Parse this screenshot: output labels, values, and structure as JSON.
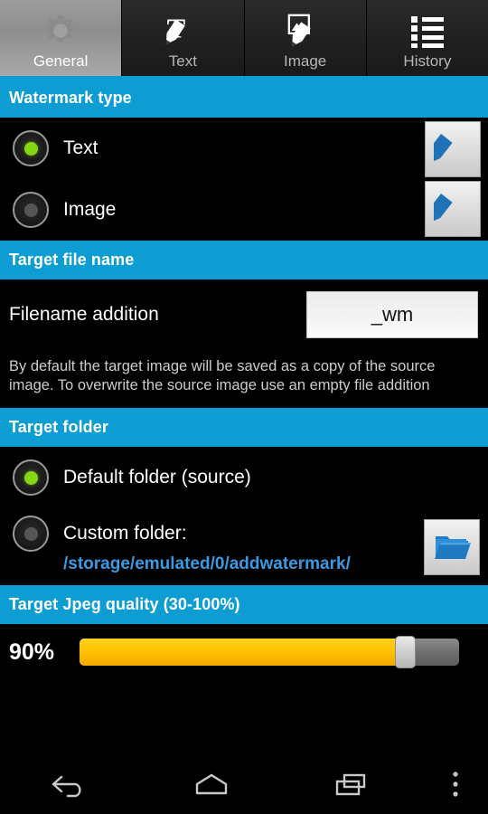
{
  "tabs": [
    {
      "label": "General",
      "icon": "gear-icon",
      "active": true
    },
    {
      "label": "Text",
      "icon": "text-pencil-icon",
      "active": false
    },
    {
      "label": "Image",
      "icon": "image-pencil-icon",
      "active": false
    },
    {
      "label": "History",
      "icon": "list-icon",
      "active": false
    }
  ],
  "sections": {
    "watermark_type": {
      "header": "Watermark type",
      "options": [
        {
          "label": "Text",
          "selected": true,
          "edit_icon": "pencil-icon"
        },
        {
          "label": "Image",
          "selected": false,
          "edit_icon": "pencil-icon"
        }
      ]
    },
    "target_file_name": {
      "header": "Target file name",
      "field_label": "Filename addition",
      "field_value": "_wm",
      "hint": "By default the target image will be saved as a copy of the source image. To overwrite the source image use an empty file addition"
    },
    "target_folder": {
      "header": "Target folder",
      "default_option": "Default folder (source)",
      "default_selected": true,
      "custom_option": "Custom folder:",
      "custom_selected": false,
      "custom_path": "/storage/emulated/0/addwatermark/",
      "browse_icon": "folder-icon"
    },
    "jpeg_quality": {
      "header": "Target Jpeg quality (30-100%)",
      "value_label": "90%",
      "value": 90,
      "min": 30,
      "max": 100
    }
  },
  "navbar": [
    {
      "name": "back-button",
      "icon": "back-arrow-icon"
    },
    {
      "name": "home-button",
      "icon": "home-icon"
    },
    {
      "name": "recents-button",
      "icon": "recents-icon"
    },
    {
      "name": "overflow-menu-button",
      "icon": "kebab-menu-icon"
    }
  ],
  "colors": {
    "accent": "#0d9dd3",
    "selected_radio": "#86d516",
    "slider_fill": "#ffc400",
    "path_link": "#3b9ae1",
    "background": "#000000"
  }
}
